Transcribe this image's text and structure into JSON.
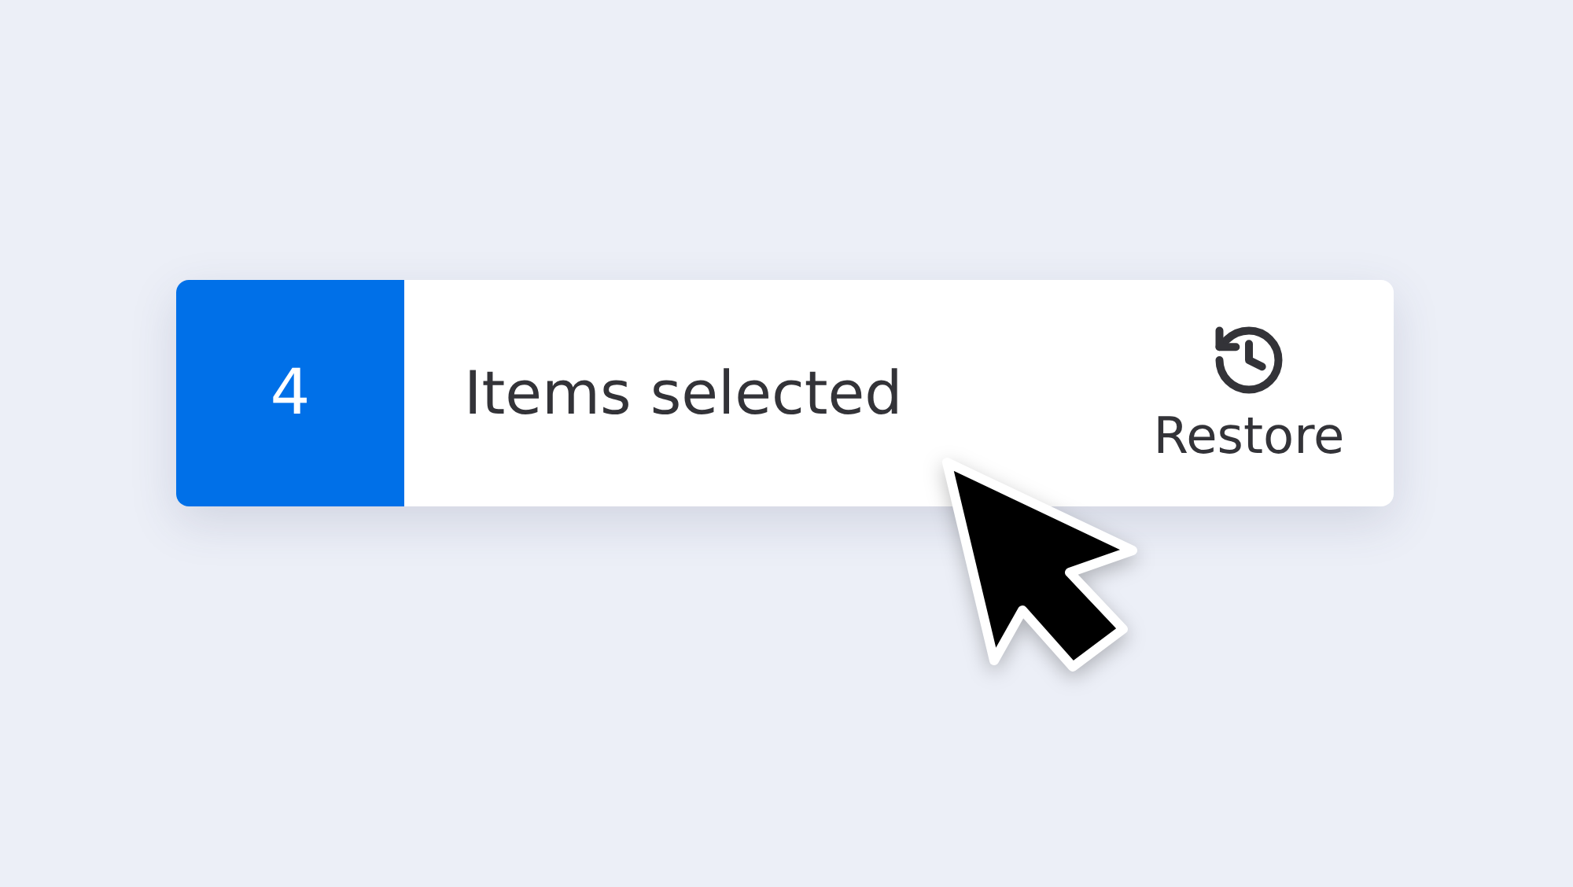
{
  "selection_bar": {
    "count": "4",
    "label": "Items selected",
    "action": {
      "label": "Restore"
    }
  }
}
